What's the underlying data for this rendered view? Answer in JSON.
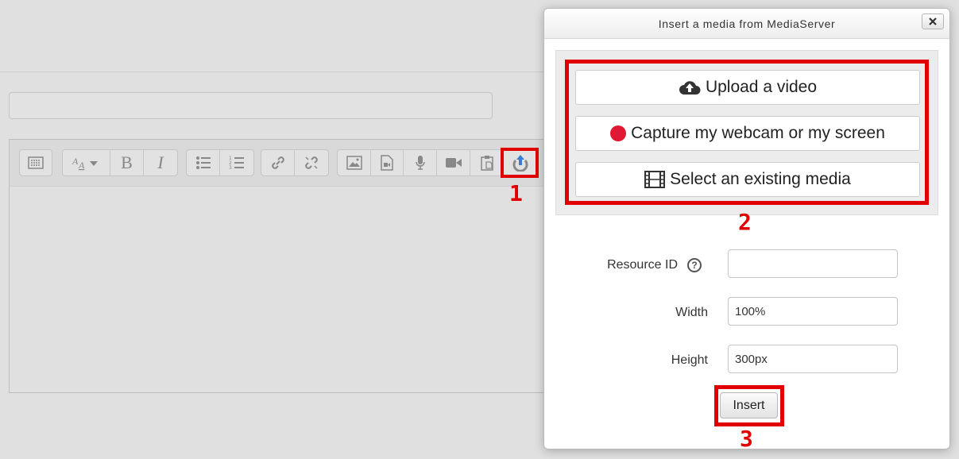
{
  "dialog": {
    "title": "Insert a media from MediaServer",
    "close_label": "close",
    "actions": {
      "upload": "Upload a video",
      "capture": "Capture my webcam or my screen",
      "select": "Select an existing media"
    },
    "form": {
      "resource_id_label": "Resource ID",
      "resource_id_value": "",
      "help_glyph": "?",
      "width_label": "Width",
      "width_value": "100%",
      "height_label": "Height",
      "height_value": "300px"
    },
    "insert_label": "Insert"
  },
  "editor": {
    "toolbar_groups": [
      [
        "collapse-icon"
      ],
      [
        "font-style-dropdown-icon",
        "bold-icon",
        "italic-icon"
      ],
      [
        "unordered-list-icon",
        "ordered-list-icon"
      ],
      [
        "link-icon",
        "unlink-icon"
      ],
      [
        "image-icon",
        "media-file-icon",
        "microphone-icon",
        "video-camera-icon",
        "paste-icon",
        "mediaserver-upload-icon"
      ]
    ],
    "bold_glyph": "B",
    "italic_glyph": "I"
  },
  "annotations": {
    "step1": "1",
    "step2": "2",
    "step3": "3"
  },
  "colors": {
    "annotation_red": "#e00000",
    "record_dot": "#e01834",
    "mediaserver_icon_blue": "#3a7bd5"
  }
}
